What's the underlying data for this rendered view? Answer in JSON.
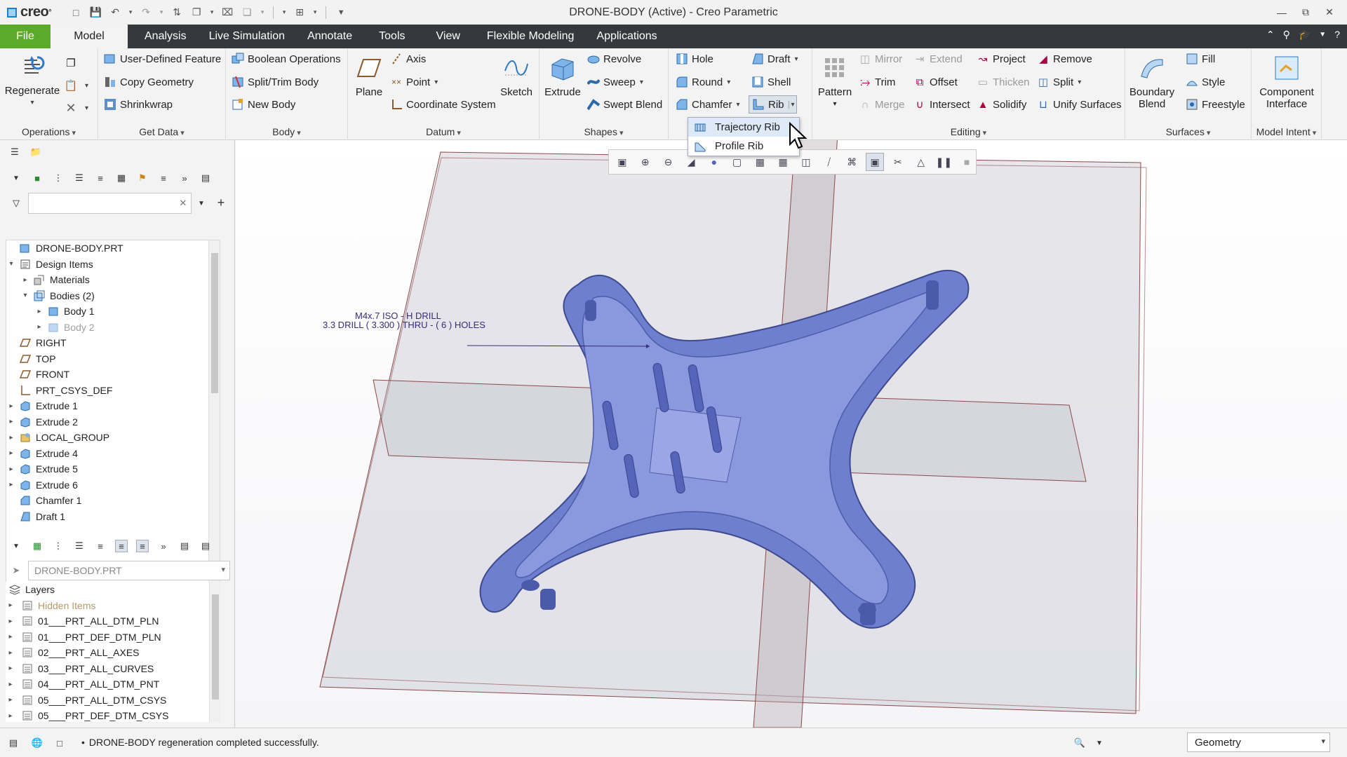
{
  "app": {
    "logo": "creo",
    "window_title": "DRONE-BODY (Active) - Creo Parametric"
  },
  "tabs": [
    "File",
    "Model",
    "Analysis",
    "Live Simulation",
    "Annotate",
    "Tools",
    "View",
    "Flexible Modeling",
    "Applications"
  ],
  "ribbon": {
    "operations": {
      "label": "Operations",
      "regenerate": "Regenerate"
    },
    "get_data": {
      "label": "Get Data",
      "user_defined_feature": "User-Defined Feature",
      "copy_geometry": "Copy Geometry",
      "shrinkwrap": "Shrinkwrap"
    },
    "body": {
      "label": "Body",
      "boolean_operations": "Boolean Operations",
      "split_trim_body": "Split/Trim Body",
      "new_body": "New Body"
    },
    "datum": {
      "label": "Datum",
      "plane": "Plane",
      "axis": "Axis",
      "point": "Point",
      "coordinate_system": "Coordinate System",
      "sketch": "Sketch"
    },
    "shapes": {
      "label": "Shapes",
      "extrude": "Extrude",
      "revolve": "Revolve",
      "sweep": "Sweep",
      "swept_blend": "Swept Blend"
    },
    "engineering": {
      "hole": "Hole",
      "round": "Round",
      "chamfer": "Chamfer",
      "draft": "Draft",
      "shell": "Shell",
      "rib": "Rib"
    },
    "editing": {
      "label": "Editing",
      "pattern": "Pattern",
      "mirror": "Mirror",
      "extend": "Extend",
      "trim": "Trim",
      "offset": "Offset",
      "merge": "Merge",
      "intersect": "Intersect",
      "project": "Project",
      "thicken": "Thicken",
      "solidify": "Solidify",
      "remove": "Remove",
      "split": "Split",
      "unify_surfaces": "Unify Surfaces"
    },
    "surfaces": {
      "label": "Surfaces",
      "boundary_blend_1": "Boundary",
      "boundary_blend_2": "Blend",
      "fill": "Fill",
      "style": "Style",
      "freestyle": "Freestyle"
    },
    "model_intent": {
      "label": "Model Intent",
      "component_interface_1": "Component",
      "component_interface_2": "Interface"
    }
  },
  "rib_menu": [
    "Trajectory Rib",
    "Profile Rib"
  ],
  "model_tree": [
    {
      "label": "DRONE-BODY.PRT",
      "level": 0,
      "exp": "",
      "icon": "part-icon"
    },
    {
      "label": "Design Items",
      "level": 0,
      "exp": "open",
      "icon": "design-items-icon"
    },
    {
      "label": "Materials",
      "level": 1,
      "exp": "closed",
      "icon": "materials-icon"
    },
    {
      "label": "Bodies (2)",
      "level": 1,
      "exp": "open",
      "icon": "bodies-icon"
    },
    {
      "label": "Body 1",
      "level": 2,
      "exp": "closed",
      "icon": "body-icon"
    },
    {
      "label": "Body 2",
      "level": 2,
      "exp": "closed",
      "icon": "body-icon",
      "dim": true
    },
    {
      "label": "RIGHT",
      "level": 0,
      "exp": "",
      "icon": "datum-plane-icon"
    },
    {
      "label": "TOP",
      "level": 0,
      "exp": "",
      "icon": "datum-plane-icon"
    },
    {
      "label": "FRONT",
      "level": 0,
      "exp": "",
      "icon": "datum-plane-icon"
    },
    {
      "label": "PRT_CSYS_DEF",
      "level": 0,
      "exp": "",
      "icon": "csys-icon"
    },
    {
      "label": "Extrude 1",
      "level": 0,
      "exp": "closed",
      "icon": "extrude-icon"
    },
    {
      "label": "Extrude 2",
      "level": 0,
      "exp": "closed",
      "icon": "extrude-icon"
    },
    {
      "label": "LOCAL_GROUP",
      "level": 0,
      "exp": "closed",
      "icon": "group-icon"
    },
    {
      "label": "Extrude 4",
      "level": 0,
      "exp": "closed",
      "icon": "extrude-icon"
    },
    {
      "label": "Extrude 5",
      "level": 0,
      "exp": "closed",
      "icon": "extrude-icon"
    },
    {
      "label": "Extrude 6",
      "level": 0,
      "exp": "closed",
      "icon": "extrude-icon"
    },
    {
      "label": "Chamfer 1",
      "level": 0,
      "exp": "",
      "icon": "chamfer-icon"
    },
    {
      "label": "Draft 1",
      "level": 0,
      "exp": "",
      "icon": "draft-icon"
    }
  ],
  "layer_panel": {
    "model": "DRONE-BODY.PRT",
    "root": "Layers",
    "items": [
      {
        "label": "Hidden Items",
        "dim": true
      },
      {
        "label": "01___PRT_ALL_DTM_PLN"
      },
      {
        "label": "01___PRT_DEF_DTM_PLN"
      },
      {
        "label": "02___PRT_ALL_AXES"
      },
      {
        "label": "03___PRT_ALL_CURVES"
      },
      {
        "label": "04___PRT_ALL_DTM_PNT"
      },
      {
        "label": "05___PRT_ALL_DTM_CSYS"
      },
      {
        "label": "05___PRT_DEF_DTM_CSYS"
      }
    ]
  },
  "annotation": {
    "line1": "M4x.7 ISO - H DRILL",
    "line2": "3.3 DRILL ( 3.300 )  THRU  - ( 6 ) HOLES"
  },
  "status": {
    "message": "DRONE-BODY regeneration completed successfully.",
    "filter": "Geometry"
  },
  "colors": {
    "file_tab": "#5caa2a",
    "tab_bar": "#35393e",
    "part_body": "#6f7fd0",
    "datum_plane": "#8c4a4a"
  }
}
